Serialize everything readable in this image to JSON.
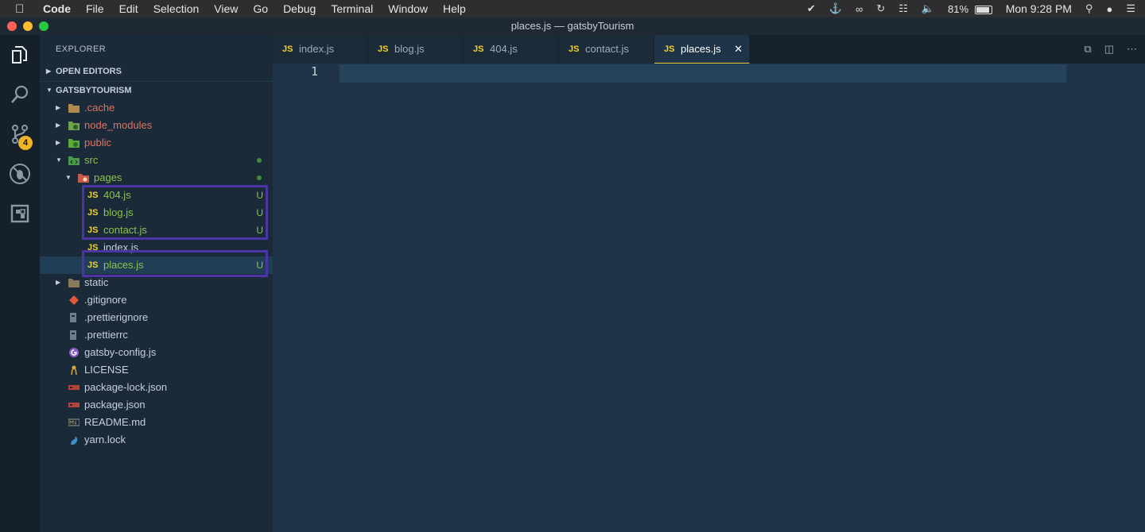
{
  "menubar": {
    "app": "Code",
    "items": [
      "File",
      "Edit",
      "Selection",
      "View",
      "Go",
      "Debug",
      "Terminal",
      "Window",
      "Help"
    ],
    "battery": "81%",
    "clock": "Mon 9:28 PM"
  },
  "window": {
    "title": "places.js — gatsbyTourism",
    "lights": [
      "#fe5f57",
      "#febc2e",
      "#28c840"
    ]
  },
  "activity_bar": {
    "icons": [
      "files-icon",
      "search-icon",
      "source-control-icon",
      "debug-icon",
      "extensions-icon"
    ],
    "scm_badge": "4",
    "badge_color": "#f0b429"
  },
  "explorer": {
    "title": "EXPLORER",
    "open_editors": "OPEN EDITORS",
    "project": "GATSBYTOURISM",
    "items": [
      {
        "label": ".cache",
        "color": "#e0735f",
        "icon": "folder-icon",
        "twistie": "collapsed"
      },
      {
        "label": "node_modules",
        "color": "#e0735f",
        "icon": "node-folder-icon",
        "twistie": "collapsed"
      },
      {
        "label": "public",
        "color": "#e0735f",
        "icon": "public-folder-icon",
        "twistie": "collapsed"
      },
      {
        "label": "src",
        "color": "#8bc34a",
        "icon": "src-folder-icon",
        "twistie": "expanded",
        "dot": true
      },
      {
        "label": "pages",
        "color": "#8bc34a",
        "icon": "pages-folder-icon",
        "twistie": "expanded",
        "dot": true
      },
      {
        "label": "404.js",
        "color": "#8bc34a",
        "icon": "js-icon",
        "status": "U"
      },
      {
        "label": "blog.js",
        "color": "#8bc34a",
        "icon": "js-icon",
        "status": "U"
      },
      {
        "label": "contact.js",
        "color": "#8bc34a",
        "icon": "js-icon",
        "status": "U"
      },
      {
        "label": "index.js",
        "color": "#c7cfd8",
        "icon": "js-icon"
      },
      {
        "label": "places.js",
        "color": "#8bc34a",
        "icon": "js-icon",
        "status": "U",
        "selected": true
      },
      {
        "label": "static",
        "color": "#c7cfd8",
        "icon": "folder-icon",
        "twistie": "collapsed"
      },
      {
        "label": ".gitignore",
        "color": "#c7cfd8",
        "icon": "git-icon"
      },
      {
        "label": ".prettierignore",
        "color": "#c7cfd8",
        "icon": "prettier-icon"
      },
      {
        "label": ".prettierrc",
        "color": "#c7cfd8",
        "icon": "prettier-icon"
      },
      {
        "label": "gatsby-config.js",
        "color": "#c7cfd8",
        "icon": "gatsby-icon"
      },
      {
        "label": "LICENSE",
        "color": "#c7cfd8",
        "icon": "license-icon"
      },
      {
        "label": "package-lock.json",
        "color": "#c7cfd8",
        "icon": "npm-icon"
      },
      {
        "label": "package.json",
        "color": "#c7cfd8",
        "icon": "npm-icon"
      },
      {
        "label": "README.md",
        "color": "#c7cfd8",
        "icon": "markdown-icon"
      },
      {
        "label": "yarn.lock",
        "color": "#c7cfd8",
        "icon": "yarn-icon"
      }
    ]
  },
  "tabs": [
    {
      "label": "index.js",
      "active": false
    },
    {
      "label": "blog.js",
      "active": false
    },
    {
      "label": "404.js",
      "active": false
    },
    {
      "label": "contact.js",
      "active": false
    },
    {
      "label": "places.js",
      "active": true
    }
  ],
  "js_badge": "JS",
  "close_glyph": "✕",
  "editor": {
    "line_number": "1"
  },
  "highlight_color": "#4d34a6"
}
